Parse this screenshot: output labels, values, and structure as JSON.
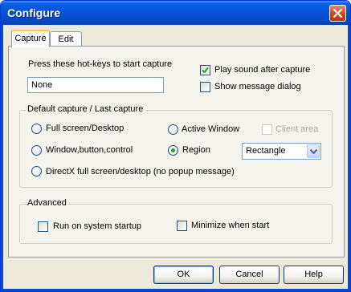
{
  "window": {
    "title": "Configure"
  },
  "tabs": [
    {
      "label": "Capture",
      "active": true
    },
    {
      "label": "Edit",
      "active": false
    }
  ],
  "capture_tab": {
    "hotkey_label": "Press these hot-keys to start capture",
    "hotkey_value": "None",
    "play_sound": {
      "label": "Play sound after capture",
      "checked": true
    },
    "show_message": {
      "label": "Show message dialog",
      "checked": false
    }
  },
  "default_capture": {
    "title": "Default capture / Last capture",
    "options": {
      "full_screen": "Full screen/Desktop",
      "active_window": "Active Window",
      "client_area": "Client area",
      "window_control": "Window,button,control",
      "region": "Region",
      "directx": "DirectX full screen/desktop (no popup message)"
    },
    "selected": "region",
    "region_shape": "Rectangle"
  },
  "advanced": {
    "title": "Advanced",
    "run_on_startup": {
      "label": "Run on system startup",
      "checked": false
    },
    "minimize_when_start": {
      "label": "Minimize when start",
      "checked": false
    }
  },
  "buttons": {
    "ok": "OK",
    "cancel": "Cancel",
    "help": "Help"
  },
  "colors": {
    "titlebar": "#0553d9",
    "dialog_bg": "#ece9d8",
    "tab_accent": "#ffc83c",
    "radio_dot": "#21a121"
  }
}
